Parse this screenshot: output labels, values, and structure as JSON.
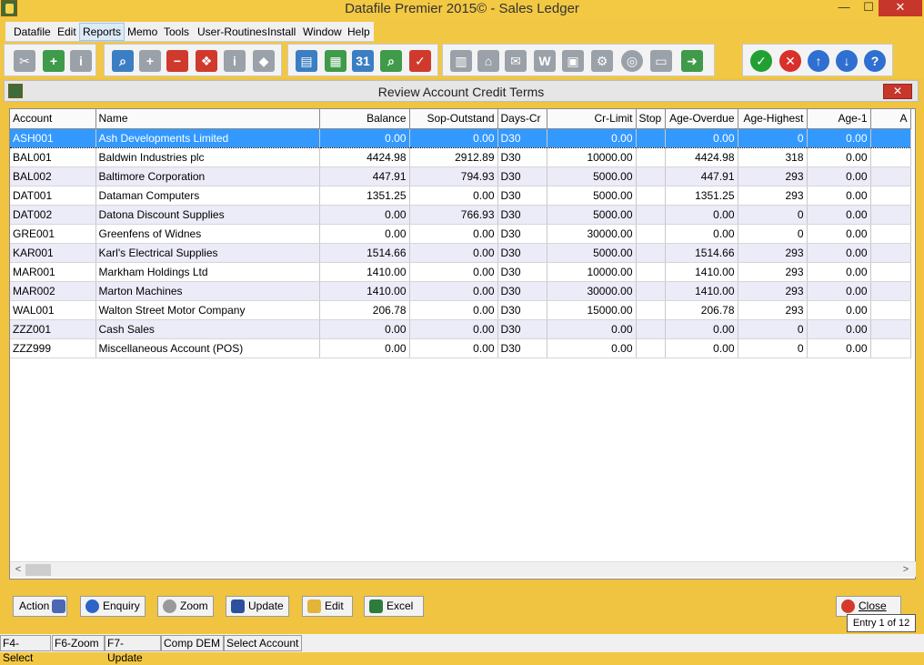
{
  "window": {
    "title": "Datafile  Premier 2015©  - Sales Ledger",
    "min_glyph": "—",
    "max_glyph": "☐",
    "close_glyph": "✕"
  },
  "menu": {
    "items": [
      "Datafile",
      "Edit",
      "Reports",
      "Memo",
      "Tools",
      "User-Routines",
      "Install",
      "Window",
      "Help"
    ],
    "active": "Reports"
  },
  "toolbar": {
    "groups": [
      [
        "scissors-icon",
        "new-document-icon",
        "document-info-icon"
      ],
      [
        "search-window-icon",
        "window-add-icon",
        "window-remove-icon",
        "gift-icon",
        "window-info-icon",
        "eraser-icon"
      ],
      [
        "document-lock-icon",
        "calculator-icon",
        "calendar-icon",
        "magnifier-money-icon",
        "checklist-icon"
      ],
      [
        "bar-chart-icon",
        "house-icon",
        "mail-icon",
        "word-document-icon",
        "image-icon",
        "window-settings-icon",
        "globe-icon",
        "printer-icon",
        "window-export-icon"
      ],
      [
        "ok-check-icon",
        "cancel-x-icon",
        "arrow-up-icon",
        "arrow-down-icon",
        "help-icon"
      ]
    ],
    "calendar_number": "31"
  },
  "doc": {
    "title": "Review Account Credit Terms",
    "close_glyph": "✕"
  },
  "grid": {
    "columns": [
      "Account",
      "Name",
      "Balance",
      "Sop-Outstand",
      "Days-Cr",
      "Cr-Limit",
      "Stop",
      "Age-Overdue",
      "Age-Highest",
      "Age-1",
      "A"
    ],
    "rows": [
      [
        "ASH001",
        "Ash Developments Limited",
        "0.00",
        "0.00",
        "D30",
        "0.00",
        "",
        "0.00",
        "0",
        "0.00",
        ""
      ],
      [
        "BAL001",
        "Baldwin Industries plc",
        "4424.98",
        "2912.89",
        "D30",
        "10000.00",
        "",
        "4424.98",
        "318",
        "0.00",
        ""
      ],
      [
        "BAL002",
        "Baltimore Corporation",
        "447.91",
        "794.93",
        "D30",
        "5000.00",
        "",
        "447.91",
        "293",
        "0.00",
        ""
      ],
      [
        "DAT001",
        "Dataman Computers",
        "1351.25",
        "0.00",
        "D30",
        "5000.00",
        "",
        "1351.25",
        "293",
        "0.00",
        ""
      ],
      [
        "DAT002",
        "Datona Discount Supplies",
        "0.00",
        "766.93",
        "D30",
        "5000.00",
        "",
        "0.00",
        "0",
        "0.00",
        ""
      ],
      [
        "GRE001",
        "Greenfens of Widnes",
        "0.00",
        "0.00",
        "D30",
        "30000.00",
        "",
        "0.00",
        "0",
        "0.00",
        ""
      ],
      [
        "KAR001",
        "Karl's Electrical Supplies",
        "1514.66",
        "0.00",
        "D30",
        "5000.00",
        "",
        "1514.66",
        "293",
        "0.00",
        ""
      ],
      [
        "MAR001",
        "Markham Holdings Ltd",
        "1410.00",
        "0.00",
        "D30",
        "10000.00",
        "",
        "1410.00",
        "293",
        "0.00",
        ""
      ],
      [
        "MAR002",
        "Marton Machines",
        "1410.00",
        "0.00",
        "D30",
        "30000.00",
        "",
        "1410.00",
        "293",
        "0.00",
        ""
      ],
      [
        "WAL001",
        "Walton Street Motor Company",
        "206.78",
        "0.00",
        "D30",
        "15000.00",
        "",
        "206.78",
        "293",
        "0.00",
        ""
      ],
      [
        "ZZZ001",
        "Cash Sales",
        "0.00",
        "0.00",
        "D30",
        "0.00",
        "",
        "0.00",
        "0",
        "0.00",
        ""
      ],
      [
        "ZZZ999",
        "Miscellaneous Account (POS)",
        "0.00",
        "0.00",
        "D30",
        "0.00",
        "",
        "0.00",
        "0",
        "0.00",
        ""
      ]
    ],
    "selected_row": 0
  },
  "scroll": {
    "left_glyph": "<",
    "right_glyph": ">"
  },
  "buttons": {
    "action": "Action",
    "enquiry": "Enquiry",
    "zoom": "Zoom",
    "update": "Update",
    "edit": "Edit",
    "excel": "Excel",
    "close": "Close"
  },
  "tooltip": "Entry 1 of 12",
  "status": [
    "F4-Select",
    "F6-Zoom",
    "F7-Update",
    "Comp DEM",
    "Select Account"
  ],
  "colors": {
    "accent_background": "#f2c744",
    "selection": "#3399ff",
    "alt_row": "#ecebf8"
  }
}
